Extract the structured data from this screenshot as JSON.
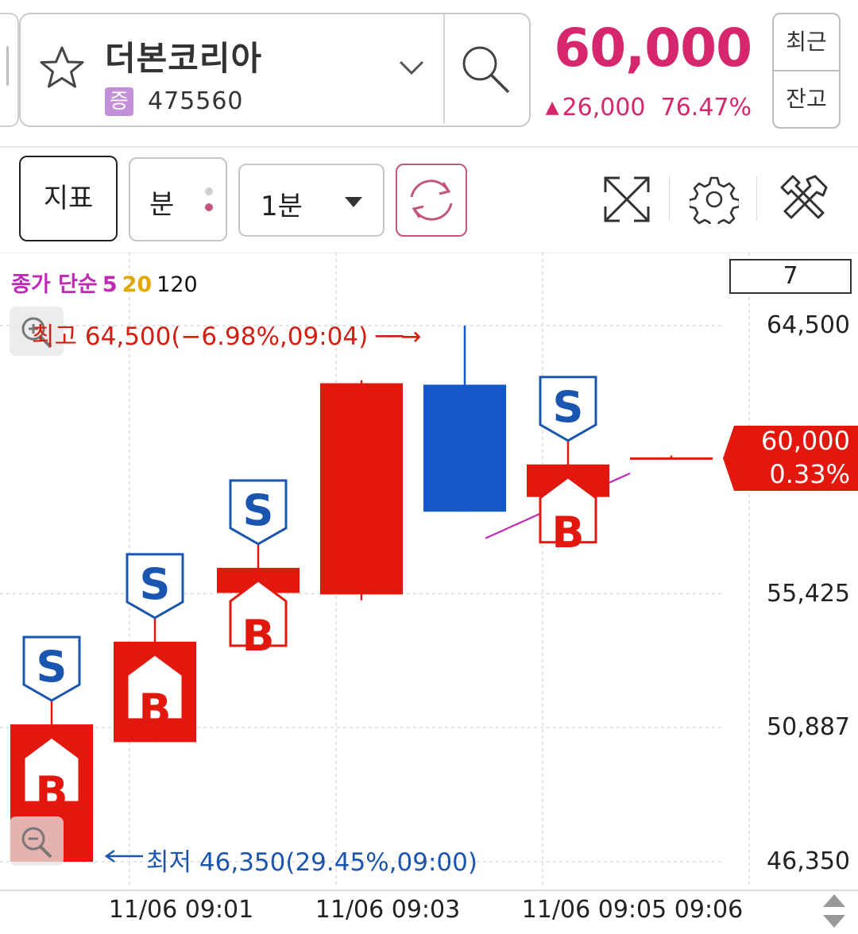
{
  "stock": {
    "name": "더본코리아",
    "badge": "증",
    "code": "475560",
    "price": "60,000",
    "change": "26,000",
    "change_rate": "76.47%"
  },
  "side_buttons": {
    "recent": "최근",
    "balance": "잔고"
  },
  "toolbar": {
    "indicator_label": "지표",
    "minute_label": "분",
    "interval_value": "1분"
  },
  "chart_header": {
    "legend_prefix": "종가 단순",
    "ma_periods": [
      "5",
      "20",
      "120"
    ],
    "ma_colors": [
      "#c029b8",
      "#e0a800",
      "#111111"
    ],
    "count_box": "7"
  },
  "annotations": {
    "high": "최고 64,500(−6.98%,09:04)",
    "low": "최저 46,350(29.45%,09:00)",
    "current_price": "60,000",
    "current_rate": "0.33%"
  },
  "colors": {
    "up": "#e2180e",
    "down": "#1458c8",
    "price": "#d6266d",
    "signal_border": "#1a56b0"
  },
  "chart_data": {
    "type": "candlestick",
    "x": [
      "09:00",
      "09:01",
      "09:02",
      "09:03",
      "09:04",
      "09:05",
      "09:06"
    ],
    "candles": [
      {
        "time": "09:00",
        "open": 46350,
        "close": 51000,
        "high": 51000,
        "low": 46350
      },
      {
        "time": "09:01",
        "open": 50400,
        "close": 53800,
        "high": 53800,
        "low": 50400
      },
      {
        "time": "09:02",
        "open": 55450,
        "close": 56300,
        "high": 56300,
        "low": 55450
      },
      {
        "time": "09:03",
        "open": 55400,
        "close": 62550,
        "high": 62650,
        "low": 55200
      },
      {
        "time": "09:04",
        "open": 62500,
        "close": 58200,
        "high": 64500,
        "low": 58200
      },
      {
        "time": "09:05",
        "open": 58700,
        "close": 59800,
        "high": 59800,
        "low": 58700
      },
      {
        "time": "09:06",
        "open": 60000,
        "close": 60000,
        "high": 60100,
        "low": 60000
      }
    ],
    "ma5": [
      [
        4.2,
        57300
      ],
      [
        5.6,
        59500
      ]
    ],
    "signals": [
      {
        "time": "09:00",
        "types": [
          "S",
          "B"
        ]
      },
      {
        "time": "09:01",
        "types": [
          "S",
          "B"
        ]
      },
      {
        "time": "09:02",
        "types": [
          "S",
          "B"
        ]
      },
      {
        "time": "09:05",
        "types": [
          "S",
          "B"
        ]
      }
    ],
    "y_ticks": [
      "64,500",
      "55,425",
      "50,887",
      "46,350"
    ],
    "y_tick_values": [
      64500,
      55425,
      50887,
      46350
    ],
    "x_ticks": [
      {
        "time": "09:01",
        "label": "11/06 09:01"
      },
      {
        "time": "09:03",
        "label": "11/06 09:03"
      },
      {
        "time": "09:05",
        "label": "11/06 09:05"
      },
      {
        "time": "09:06",
        "label": "09:06"
      }
    ],
    "ylim": [
      46350,
      64500
    ],
    "grid": true
  }
}
